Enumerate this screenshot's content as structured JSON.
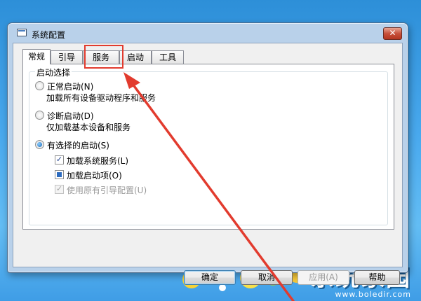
{
  "window": {
    "title": "系统配置",
    "close_label": "✕"
  },
  "tabs": [
    {
      "label": "常规"
    },
    {
      "label": "引导"
    },
    {
      "label": "服务"
    },
    {
      "label": "启动"
    },
    {
      "label": "工具"
    }
  ],
  "startup_group": {
    "label": "启动选择",
    "normal": {
      "label": "正常启动(N)",
      "desc": "加载所有设备驱动程序和服务"
    },
    "diagnostic": {
      "label": "诊断启动(D)",
      "desc": "仅加载基本设备和服务"
    },
    "selective": {
      "label": "有选择的启动(S)"
    },
    "load_services": {
      "label": "加载系统服务(L)"
    },
    "load_startup": {
      "label": "加载启动项(O)"
    },
    "use_boot": {
      "label": "使用原有引导配置(U)"
    }
  },
  "buttons": {
    "ok": "确定",
    "cancel": "取消",
    "apply": "应用(A)",
    "help": "帮助"
  },
  "watermark": {
    "text": "系统家园",
    "url": "www.boledir.com"
  },
  "colors": {
    "highlight": "#e23b2e",
    "desktop": "#49a9ee"
  }
}
